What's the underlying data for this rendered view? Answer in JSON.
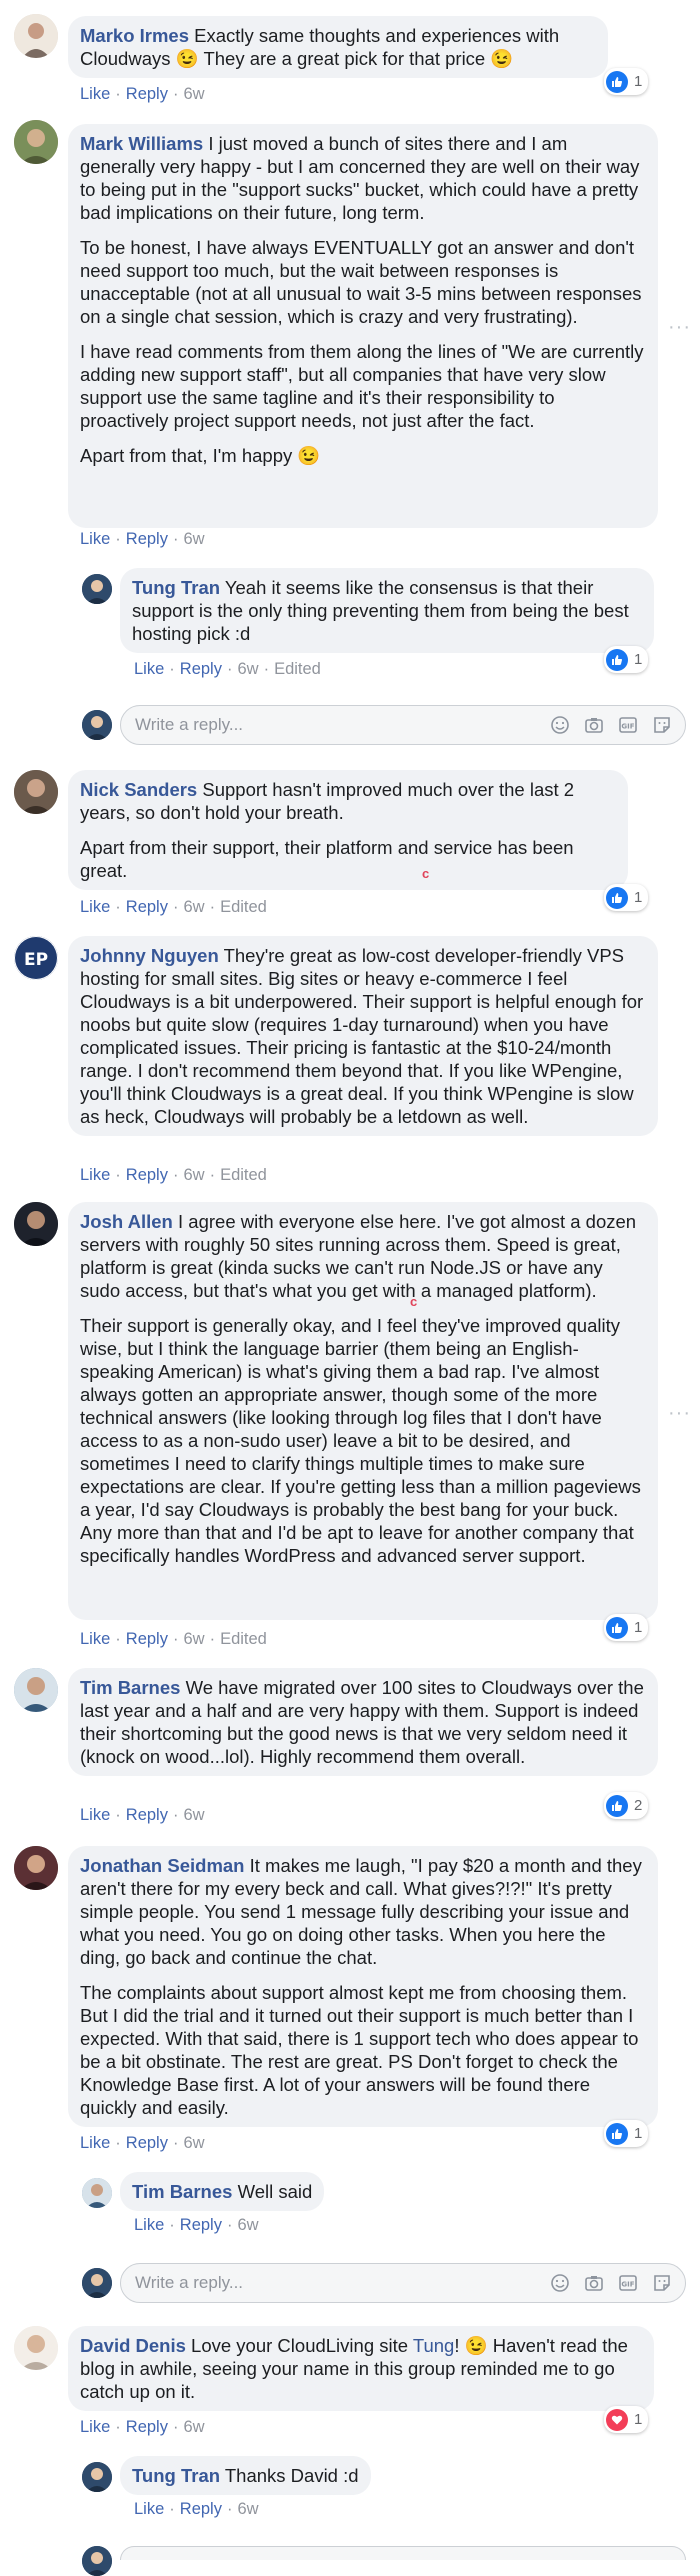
{
  "comments": [
    {
      "author": "Marko Irmes",
      "text": "Exactly same thoughts and experiences with Cloudways 😉 They are a great pick for that price 😉",
      "like": "Like",
      "reply": "Reply",
      "time": "6w",
      "reactions": "1"
    },
    {
      "author": "Mark Williams",
      "p1": "I just moved a bunch of sites there and I am generally very happy - but I am concerned they are well on their way to being put in the \"support sucks\" bucket, which could have a pretty bad implications on their future, long term.",
      "p2": "To be honest, I have always EVENTUALLY got an answer and don't need support too much, but the wait between responses is unacceptable (not at all unusual to wait 3-5 mins between responses on a single chat session, which is crazy and very frustrating).",
      "p3": "I have read comments from them along the lines of \"We are currently adding new support staff\", but all companies that have very slow support use the same tagline and it's their responsibility to proactively project support needs, not just after the fact.",
      "p4": "Apart from that, I'm happy 😉",
      "like": "Like",
      "reply": "Reply",
      "time": "6w"
    },
    {
      "author": "Tung Tran",
      "text": "Yeah it seems like the consensus is that their support is the only thing preventing them from being the best hosting pick :d",
      "like": "Like",
      "reply": "Reply",
      "time": "6w",
      "edited": "Edited",
      "reactions": "1"
    },
    {
      "author": "Nick Sanders",
      "p1": "Support hasn't improved much over the last 2 years, so don't hold your breath.",
      "p2": "Apart from their support, their platform and service has been great.",
      "like": "Like",
      "reply": "Reply",
      "time": "6w",
      "edited": "Edited",
      "reactions": "1"
    },
    {
      "author": "Johnny Nguyen",
      "text": "They're great as low-cost developer-friendly VPS hosting for small sites. Big sites or heavy e-commerce I feel Cloudways is a bit underpowered. Their support is helpful enough for noobs but quite slow (requires 1-day turnaround) when you have complicated issues. Their pricing is fantastic at the $10-24/month range. I don't recommend them beyond that. If you like WPengine, you'll think Cloudways is a great deal. If you think WPengine is slow as heck, Cloudways will probably be a letdown as well.",
      "like": "Like",
      "reply": "Reply",
      "time": "6w",
      "edited": "Edited"
    },
    {
      "author": "Josh Allen",
      "p1": "I agree with everyone else here. I've got almost a dozen servers with roughly 50 sites running across them. Speed is great, platform is great (kinda sucks we can't run Node.JS or have any sudo access, but that's what you get with a managed platform).",
      "p2": "Their support is generally okay, and I feel they've improved quality wise, but I think the language barrier (them being an English-speaking American) is what's giving them a bad rap. I've almost always gotten an appropriate answer, though some of the more technical answers (like looking through log files that I don't have access to as a non-sudo user) leave a bit to be desired, and sometimes I need to clarify things multiple times to make sure expectations are clear. If you're getting less than a million pageviews a year, I'd say Cloudways is probably the best bang for your buck. Any more than that and I'd be apt to leave for another company that specifically handles WordPress and advanced server support.",
      "like": "Like",
      "reply": "Reply",
      "time": "6w",
      "edited": "Edited",
      "reactions": "1"
    },
    {
      "author": "Tim Barnes",
      "text": "We have migrated over 100 sites to Cloudways over the last year and a half and are very happy with them. Support is indeed their shortcoming but the good news is that we very seldom need it (knock on wood...lol). Highly recommend them overall.",
      "like": "Like",
      "reply": "Reply",
      "time": "6w",
      "reactions": "2"
    },
    {
      "author": "Jonathan Seidman",
      "p1": "It makes me laugh, \"I pay $20 a month and they aren't there for my every beck and call. What gives?!?!\" It's pretty simple people. You send 1 message fully describing your issue and what you need. You go on doing other tasks. When you here the ding, go back and continue the chat.",
      "p2": "The complaints about support almost kept me from choosing them. But I did the trial and it turned out their support is much better than I expected. With that said, there is 1 support tech who does appear to be a bit obstinate. The rest are great. PS Don't forget to check the Knowledge Base first. A lot of your answers will be found there quickly and easily.",
      "like": "Like",
      "reply": "Reply",
      "time": "6w",
      "reactions": "1"
    },
    {
      "author": "Tim Barnes",
      "text": "Well said",
      "like": "Like",
      "reply": "Reply",
      "time": "6w"
    },
    {
      "author": "David Denis",
      "text_a": "Love your CloudLiving site ",
      "mention": "Tung",
      "text_b": "! 😉 Haven't read the blog in awhile, seeing your name in this group reminded me to go catch up on it.",
      "like": "Like",
      "reply": "Reply",
      "time": "6w",
      "reactions": "1"
    },
    {
      "author": "Tung Tran",
      "text": "Thanks David :d",
      "like": "Like",
      "reply": "Reply",
      "time": "6w"
    }
  ],
  "reply_box": {
    "placeholder": "Write a reply..."
  },
  "colors": {
    "like_blue": "#1877f2",
    "love_red": "#f33e58",
    "link": "#385898",
    "bubble": "#f0f2f5"
  }
}
